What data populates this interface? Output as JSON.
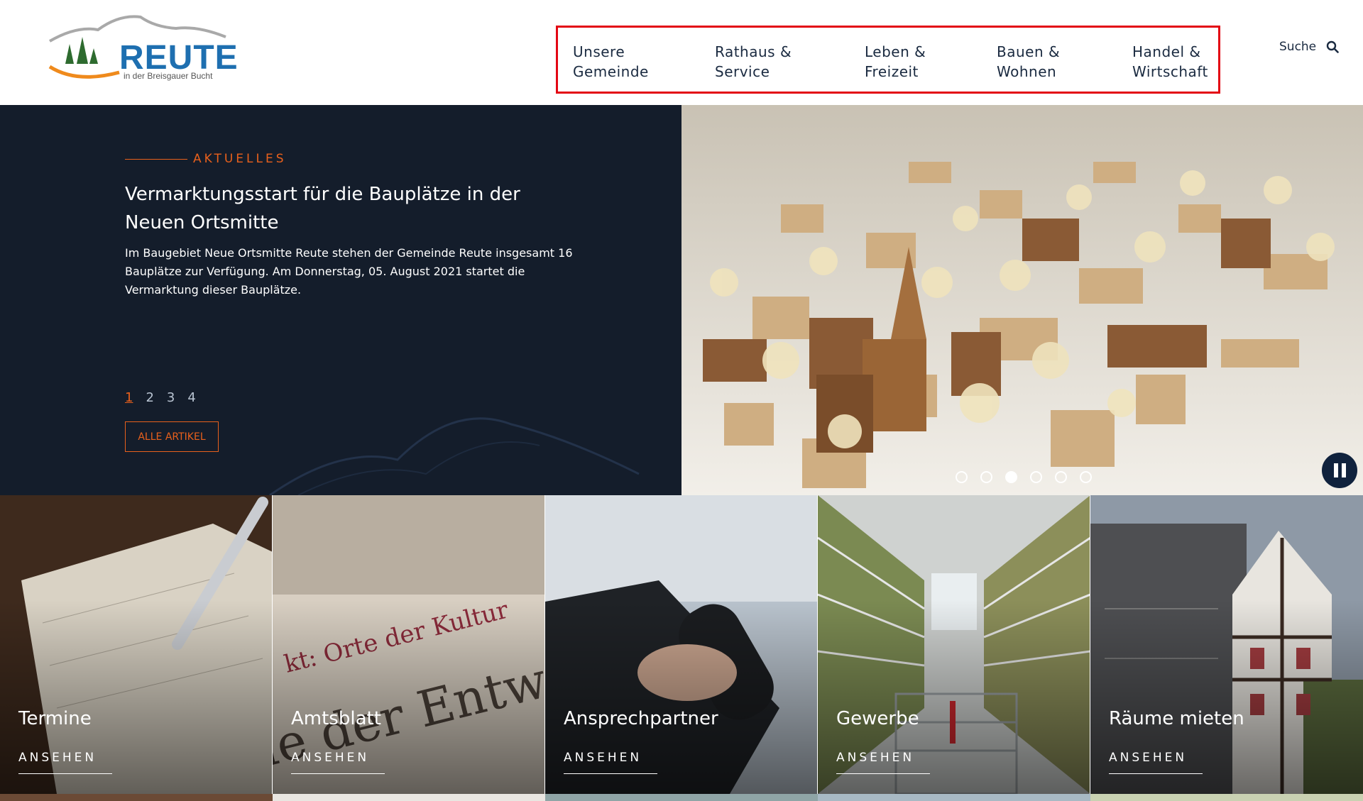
{
  "logo": {
    "word": "REUTE",
    "subtitle": "in der Breisgauer Bucht"
  },
  "nav": {
    "items": [
      {
        "label": "Unsere\nGemeinde"
      },
      {
        "label": "Rathaus &\nService"
      },
      {
        "label": "Leben &\nFreizeit"
      },
      {
        "label": "Bauen &\nWohnen"
      },
      {
        "label": "Handel &\nWirtschaft"
      }
    ]
  },
  "search": {
    "label": "Suche",
    "icon": "search-icon"
  },
  "hero": {
    "kicker": "AKTUELLES",
    "title": "Vermarktungsstart für die Bauplätze in der Neuen Ortsmitte",
    "text": "Im Baugebiet Neue Ortsmitte Reute stehen der Gemeinde Reute insgesamt 16 Bauplätze zur Verfügung. Am Donnerstag, 05. August 2021 startet die Vermarktung dieser Bauplätze.",
    "pages": [
      "1",
      "2",
      "3",
      "4"
    ],
    "active_page": 0,
    "all_button": "ALLE ARTIKEL"
  },
  "carousel": {
    "dot_count": 6,
    "active_dot": 2,
    "pause_icon": "pause-icon"
  },
  "tiles": [
    {
      "title": "Termine",
      "link": "ANSEHEN"
    },
    {
      "title": "Amtsblatt",
      "link": "ANSEHEN"
    },
    {
      "title": "Ansprechpartner",
      "link": "ANSEHEN"
    },
    {
      "title": "Gewerbe",
      "link": "ANSEHEN"
    },
    {
      "title": "Räume mieten",
      "link": "ANSEHEN"
    }
  ],
  "colors": {
    "accent": "#e8601c",
    "navy": "#141d2b",
    "highlight": "#e30613",
    "brand": "#1e6fb0"
  }
}
